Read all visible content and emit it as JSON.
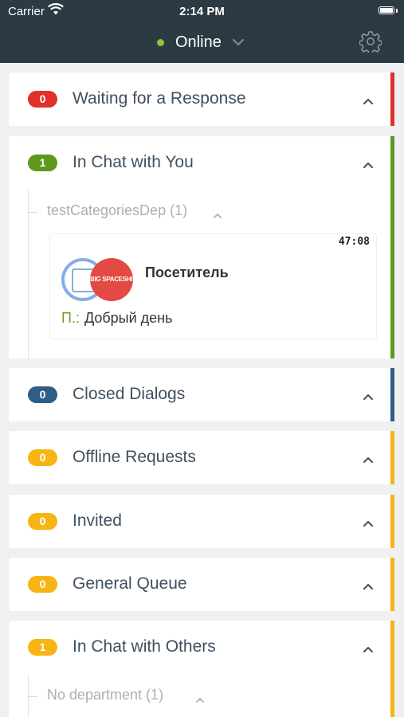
{
  "status_bar": {
    "carrier": "Carrier",
    "time": "2:14 PM"
  },
  "header": {
    "status_label": "Online",
    "status_color": "#8cc63f",
    "icons": [
      "wifi-icon",
      "battery-icon",
      "chevron-down-icon",
      "gear-icon"
    ]
  },
  "sections": [
    {
      "count": "0",
      "title": "Waiting for a Response",
      "color": "#e0302b"
    },
    {
      "count": "1",
      "title": "In Chat with You",
      "color": "#5e981d"
    },
    {
      "count": "0",
      "title": "Closed Dialogs",
      "color": "#2f5d87"
    },
    {
      "count": "0",
      "title": "Offline Requests",
      "color": "#f6b515"
    },
    {
      "count": "0",
      "title": "Invited",
      "color": "#f6b515"
    },
    {
      "count": "0",
      "title": "General Queue",
      "color": "#f6b515"
    },
    {
      "count": "1",
      "title": "In Chat with Others",
      "color": "#f6b515"
    }
  ],
  "in_chat_with_you": {
    "department": "testCategoriesDep (1)",
    "chat": {
      "timer": "47:08",
      "avatar_text": "BIG SPACESHIP",
      "visitor_name": "Посетитель",
      "message_prefix": "П.:",
      "message": "Добрый день"
    }
  },
  "in_chat_with_others": {
    "department": "No department (1)"
  }
}
